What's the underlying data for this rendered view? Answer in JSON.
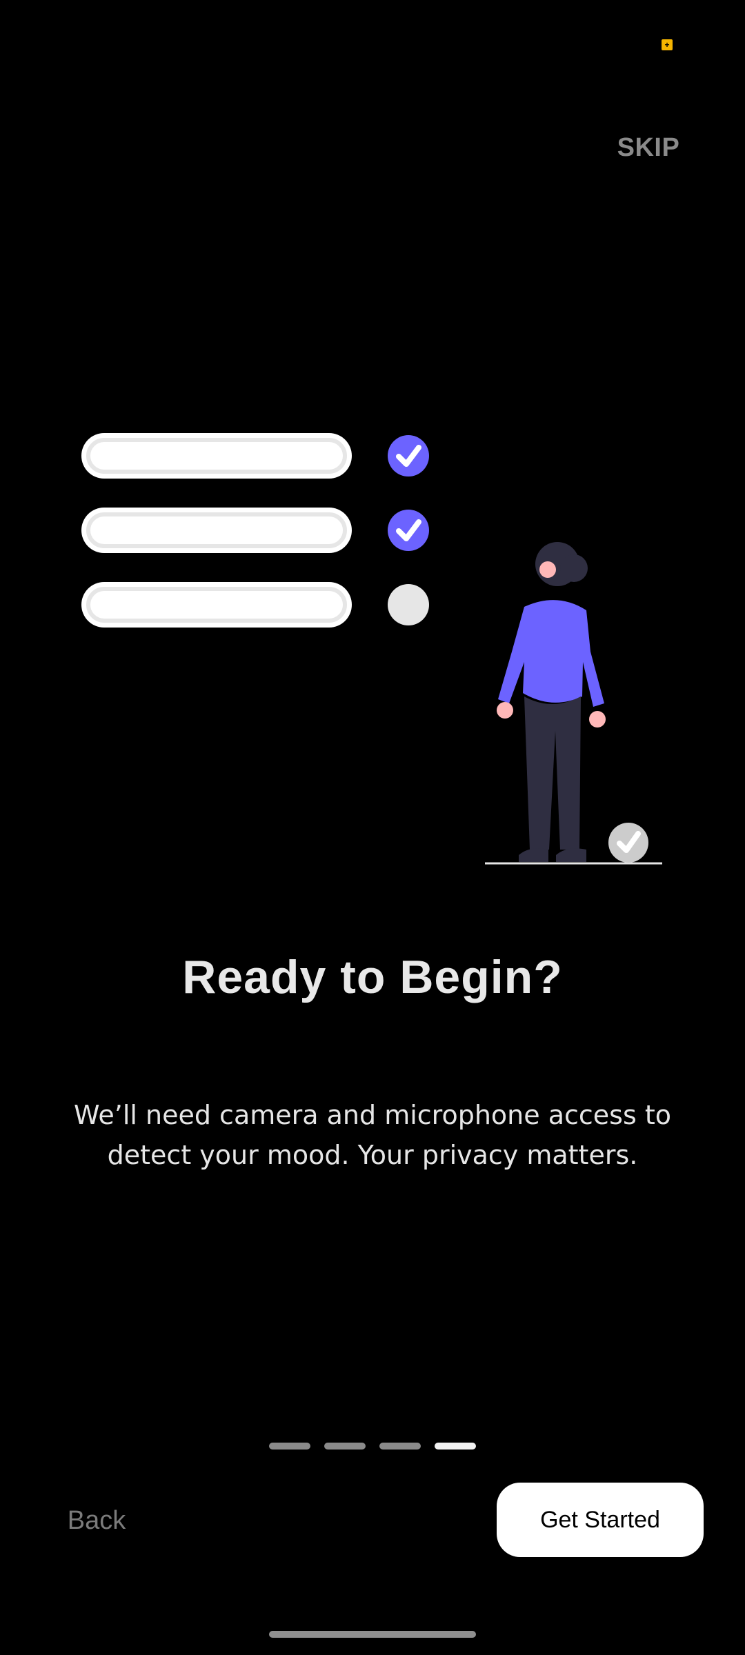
{
  "status_bar": {
    "indicator_icon": "notification-badge-icon",
    "indicator_color": "#f5b400"
  },
  "onboarding": {
    "skip_label": "SKIP",
    "title": "Ready to Begin?",
    "description": "We’ll need camera and microphone access to detect your mood. Your privacy matters.",
    "pager": {
      "total": 4,
      "current": 4
    },
    "back_label": "Back",
    "cta_label": "Get Started"
  },
  "illustration": {
    "accent": "#6c63ff",
    "checklist": [
      {
        "checked": true
      },
      {
        "checked": true
      },
      {
        "checked": false
      }
    ]
  }
}
